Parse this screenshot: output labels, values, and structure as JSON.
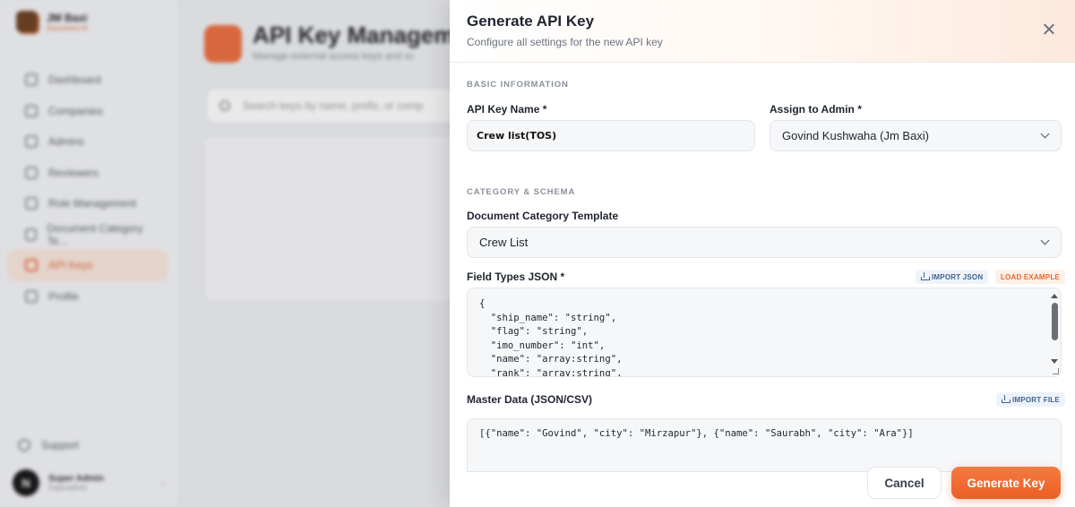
{
  "background": {
    "brand": {
      "name": "JM Baxi",
      "subtitle": "Document AI"
    },
    "nav": [
      {
        "label": "Dashboard",
        "icon": "grid-icon"
      },
      {
        "label": "Companies",
        "icon": "building-icon"
      },
      {
        "label": "Admins",
        "icon": "users-icon"
      },
      {
        "label": "Reviewers",
        "icon": "user-check-icon"
      },
      {
        "label": "Role Management",
        "icon": "shield-icon"
      },
      {
        "label": "Document Category Te...",
        "icon": "file-icon"
      },
      {
        "label": "API Keys",
        "icon": "key-icon",
        "active": true
      },
      {
        "label": "Profile",
        "icon": "user-icon"
      }
    ],
    "support_label": "Support",
    "user": {
      "initial": "N",
      "name": "Super Admin",
      "role": "Superadmin"
    },
    "page_title": "API Key Manageme",
    "page_subtitle": "Manage external access keys and sc",
    "search_placeholder": "Search keys by name, prefix, or comp"
  },
  "modal": {
    "title": "Generate API Key",
    "subtitle": "Configure all settings for the new API key",
    "basic_section": "BASIC INFORMATION",
    "api_key_name_label": "API Key Name *",
    "api_key_name_value": "Crew list(TOS)",
    "assign_admin_label": "Assign to Admin *",
    "assign_admin_value": "Govind Kushwaha (Jm Baxi)",
    "category_section": "CATEGORY & SCHEMA",
    "template_label": "Document Category Template",
    "template_value": "Crew List",
    "field_types_label": "Field Types JSON *",
    "import_json_label": "IMPORT JSON",
    "load_example_label": "LOAD EXAMPLE",
    "field_types_json": "{\n  \"ship_name\": \"string\",\n  \"flag\": \"string\",\n  \"imo_number\": \"int\",\n  \"name\": \"array:string\",\n  \"rank\": \"array:string\",",
    "master_data_label": "Master Data (JSON/CSV)",
    "import_file_label": "IMPORT FILE",
    "master_data_value": "[{\"name\": \"Govind\", \"city\": \"Mirzapur\"}, {\"name\": \"Saurabh\", \"city\": \"Ara\"}]",
    "cancel_label": "Cancel",
    "generate_label": "Generate Key"
  },
  "colors": {
    "accent": "#ec6b3b",
    "pill_blue": "#41638f",
    "pill_orange": "#e5672e"
  }
}
